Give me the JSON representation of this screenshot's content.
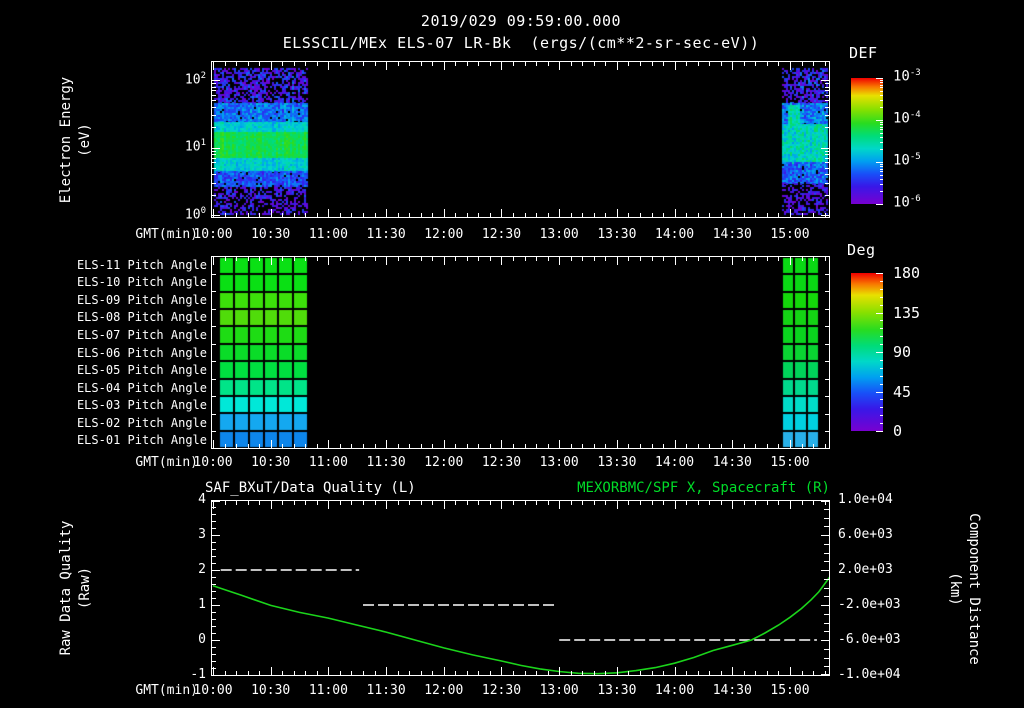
{
  "header": {
    "timestamp": "2019/029 09:59:00.000",
    "plot_title": "ELSSCIL/MEx ELS-07 LR-Bk  (ergs/(cm**2-sr-sec-eV))"
  },
  "axis": {
    "x_label": "GMT(min)",
    "x_ticks": [
      "10:00",
      "10:30",
      "11:00",
      "11:30",
      "12:00",
      "12:30",
      "13:00",
      "13:30",
      "14:00",
      "14:30",
      "15:00"
    ],
    "x_tick_minutes": [
      0,
      30,
      60,
      90,
      120,
      150,
      180,
      210,
      240,
      270,
      300
    ],
    "x_range_minutes": [
      0,
      321
    ]
  },
  "panel1": {
    "y_label_line1": "Electron Energy",
    "y_label_line2": "(eV)",
    "y_ticks": [
      {
        "base": "10",
        "exp": "2"
      },
      {
        "base": "10",
        "exp": "1"
      },
      {
        "base": "10",
        "exp": "0"
      }
    ],
    "colorbar": {
      "title": "DEF",
      "tick_labels": [
        {
          "base": "10",
          "exp": "-3"
        },
        {
          "base": "10",
          "exp": "-4"
        },
        {
          "base": "10",
          "exp": "-5"
        },
        {
          "base": "10",
          "exp": "-6"
        }
      ]
    }
  },
  "panel2": {
    "row_labels": [
      "ELS-11 Pitch Angle",
      "ELS-10 Pitch Angle",
      "ELS-09 Pitch Angle",
      "ELS-08 Pitch Angle",
      "ELS-07 Pitch Angle",
      "ELS-06 Pitch Angle",
      "ELS-05 Pitch Angle",
      "ELS-04 Pitch Angle",
      "ELS-03 Pitch Angle",
      "ELS-02 Pitch Angle",
      "ELS-01 Pitch Angle"
    ],
    "colorbar": {
      "title": "Deg",
      "tick_labels": [
        "180",
        "135",
        "90",
        "45",
        "0"
      ]
    }
  },
  "panel3": {
    "title_left": "SAF_BXuT/Data Quality (L)",
    "title_right": "MEXORBMC/SPF X, Spacecraft (R)",
    "y_label_line1": "Raw Data Quality",
    "y_label_line2": "(Raw)",
    "right_label_line1": "Component Distance",
    "right_label_line2": "(km)",
    "left_ticks": [
      "4",
      "3",
      "2",
      "1",
      "0",
      "-1"
    ],
    "right_ticks": [
      "1.0e+04",
      "6.0e+03",
      "2.0e+03",
      "-2.0e+03",
      "-6.0e+03",
      "-1.0e+04"
    ]
  },
  "colors": {
    "background": "#000000",
    "text": "#ffffff",
    "title_right_green": "#00dc28",
    "curve_green": "#1bd41b",
    "quality_line": "#ffffff",
    "rainbow_stops": [
      [
        0,
        "#7800d0"
      ],
      [
        0.14,
        "#3818e8"
      ],
      [
        0.24,
        "#1850f8"
      ],
      [
        0.34,
        "#00a0f0"
      ],
      [
        0.44,
        "#00d8c8"
      ],
      [
        0.54,
        "#00dc78"
      ],
      [
        0.64,
        "#28dc20"
      ],
      [
        0.75,
        "#88e000"
      ],
      [
        0.86,
        "#e8e000"
      ],
      [
        0.93,
        "#f87800"
      ],
      [
        1,
        "#f00000"
      ]
    ]
  },
  "chart_data": [
    {
      "type": "heatmap",
      "name": "electron-energy-spectrogram",
      "title": "ELSSCIL/MEx ELS-07 LR-Bk",
      "value_unit": "ergs/(cm**2-sr-sec-eV)",
      "x_unit": "minutes after 10:00 GMT",
      "ylabel": "Electron Energy (eV)",
      "y_scale": "log",
      "ylim": [
        1,
        190
      ],
      "value_log10_range": [
        -6,
        -3
      ],
      "blocks": [
        {
          "x_min": [
            0.5,
            49.5
          ],
          "bands": [
            {
              "energy_ev": [
                45,
                150
              ],
              "log10def": -5.65,
              "noise": 0.45,
              "dropout": 0.3
            },
            {
              "energy_ev": [
                24,
                45
              ],
              "log10def": -5.15,
              "noise": 0.3,
              "dropout": 0.05
            },
            {
              "energy_ev": [
                17,
                24
              ],
              "log10def": -4.75,
              "noise": 0.2,
              "dropout": 0
            },
            {
              "energy_ev": [
                7,
                17
              ],
              "log10def": -4.25,
              "noise": 0.15,
              "dropout": 0
            },
            {
              "energy_ev": [
                4.5,
                7
              ],
              "log10def": -4.75,
              "noise": 0.2,
              "dropout": 0
            },
            {
              "energy_ev": [
                2.6,
                4.5
              ],
              "log10def": -5.3,
              "noise": 0.3,
              "dropout": 0.08
            },
            {
              "energy_ev": [
                1,
                2.6
              ],
              "log10def": -5.75,
              "noise": 0.45,
              "dropout": 0.35
            }
          ]
        },
        {
          "x_min": [
            296,
            320
          ],
          "bands": [
            {
              "energy_ev": [
                45,
                150
              ],
              "log10def": -5.6,
              "noise": 0.45,
              "dropout": 0.3
            },
            {
              "energy_ev": [
                22,
                45
              ],
              "log10def": -5.15,
              "noise": 0.35,
              "dropout": 0.05
            },
            {
              "energy_ev": [
                6,
                22
              ],
              "log10def": -4.65,
              "noise": 0.3,
              "dropout": 0
            },
            {
              "energy_ev": [
                3,
                6
              ],
              "log10def": -5.25,
              "noise": 0.35,
              "dropout": 0.08
            },
            {
              "energy_ev": [
                1,
                3
              ],
              "log10def": -5.8,
              "noise": 0.45,
              "dropout": 0.35
            }
          ],
          "plume": {
            "x_min": [
              298,
              305
            ],
            "energy_ev": [
              20,
              45
            ],
            "log10def": -4.55,
            "noise": 0.25
          }
        }
      ]
    },
    {
      "type": "heatmap",
      "name": "pitch-angle-panels",
      "value_unit": "deg",
      "vlim": [
        0,
        180
      ],
      "rows": [
        "ELS-11",
        "ELS-10",
        "ELS-09",
        "ELS-08",
        "ELS-07",
        "ELS-06",
        "ELS-05",
        "ELS-04",
        "ELS-03",
        "ELS-02",
        "ELS-01"
      ],
      "blocks": [
        {
          "x_min": [
            3,
            49.5
          ],
          "columns": 6,
          "row_deg": [
            104,
            104,
            112,
            114,
            106,
            101,
            93,
            84,
            68,
            59,
            48
          ],
          "row_colors": [
            "#0ae014",
            "#0ae014",
            "#3ce00a",
            "#50dc0a",
            "#1edc14",
            "#0adc28",
            "#00e040",
            "#00e488",
            "#00e8d8",
            "#14a8f0",
            "#0d86ec"
          ]
        },
        {
          "x_min": [
            296,
            315
          ],
          "columns": 3,
          "row_deg": [
            101,
            101,
            104,
            103,
            102,
            99,
            93,
            85,
            73,
            66,
            55
          ],
          "row_colors": [
            "#0ad814",
            "#0ad814",
            "#14d80a",
            "#14d414",
            "#0ad41e",
            "#0ad432",
            "#00d45a",
            "#00d88c",
            "#00dcc8",
            "#00d0e0",
            "#28b0e8"
          ]
        }
      ]
    },
    {
      "type": "line",
      "name": "quality-and-spacecraft-position",
      "x_unit": "minutes after 10:00 GMT",
      "left_axis": {
        "label": "Raw Data Quality (Raw)",
        "range": [
          -1,
          4
        ]
      },
      "right_axis": {
        "label": "Component Distance (km)",
        "range": [
          -10000,
          10000
        ]
      },
      "series": [
        {
          "name": "SAF_BXuT/Data Quality (L)",
          "axis": "left",
          "style": "dashed_white",
          "segments": [
            {
              "t": [
                4,
                76
              ],
              "v": 2
            },
            {
              "t": [
                78,
                179
              ],
              "v": 1
            },
            {
              "t": [
                180,
                314
              ],
              "v": 0
            }
          ]
        },
        {
          "name": "MEXORBMC/SPF X, Spacecraft (R)",
          "axis": "right",
          "style": "solid_green",
          "points": [
            [
              0,
              200
            ],
            [
              15,
              -900
            ],
            [
              30,
              -2050
            ],
            [
              45,
              -2850
            ],
            [
              60,
              -3500
            ],
            [
              75,
              -4300
            ],
            [
              90,
              -5100
            ],
            [
              105,
              -6000
            ],
            [
              120,
              -6900
            ],
            [
              135,
              -7700
            ],
            [
              150,
              -8400
            ],
            [
              160,
              -8900
            ],
            [
              170,
              -9300
            ],
            [
              180,
              -9600
            ],
            [
              190,
              -9800
            ],
            [
              200,
              -9850
            ],
            [
              210,
              -9750
            ],
            [
              220,
              -9500
            ],
            [
              230,
              -9150
            ],
            [
              240,
              -8650
            ],
            [
              250,
              -8000
            ],
            [
              260,
              -7200
            ],
            [
              270,
              -6600
            ],
            [
              280,
              -6000
            ],
            [
              287,
              -5200
            ],
            [
              294,
              -4300
            ],
            [
              300,
              -3400
            ],
            [
              306,
              -2400
            ],
            [
              311,
              -1400
            ],
            [
              315,
              -500
            ],
            [
              318,
              400
            ],
            [
              321,
              1300
            ]
          ]
        }
      ]
    }
  ]
}
